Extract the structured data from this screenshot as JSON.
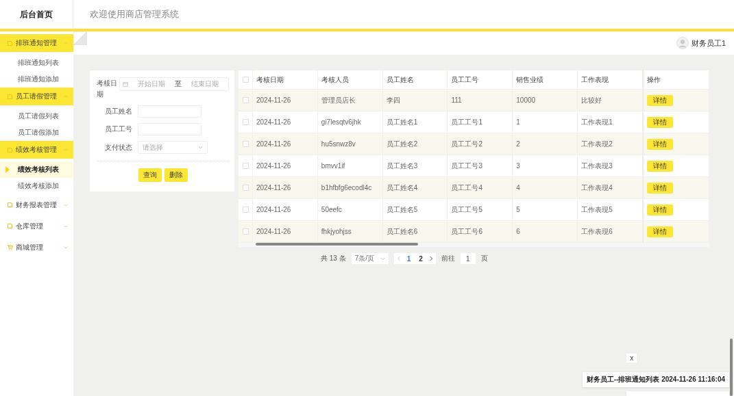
{
  "header": {
    "brand": "后台首页",
    "title": "欢迎使用商店管理系统"
  },
  "sidebar": {
    "groups": [
      {
        "label": "排班通知管理",
        "kind": "note",
        "expanded": true,
        "children": [
          {
            "label": "排班通知列表",
            "selected": false
          },
          {
            "label": "排班通知添加",
            "selected": false
          }
        ]
      },
      {
        "label": "员工请假管理",
        "kind": "note",
        "expanded": true,
        "children": [
          {
            "label": "员工请假列表",
            "selected": false
          },
          {
            "label": "员工请假添加",
            "selected": false
          }
        ]
      },
      {
        "label": "绩效考核管理",
        "kind": "note",
        "expanded": true,
        "children": [
          {
            "label": "绩效考核列表",
            "selected": true
          },
          {
            "label": "绩效考核添加",
            "selected": false
          }
        ]
      },
      {
        "label": "财务报表管理",
        "kind": "note",
        "expanded": false
      },
      {
        "label": "仓库管理",
        "kind": "note",
        "expanded": false
      },
      {
        "label": "商城管理",
        "kind": "cart",
        "expanded": false
      }
    ]
  },
  "user": {
    "name": "财务员工1"
  },
  "search_form": {
    "date_label": "考核日期",
    "start_placeholder": "开始日期",
    "separator": "至",
    "end_placeholder": "结束日期",
    "fields": [
      {
        "label": "员工姓名",
        "kind": "text"
      },
      {
        "label": "员工工号",
        "kind": "text"
      },
      {
        "label": "支付状态",
        "kind": "select",
        "placeholder": "请选择"
      }
    ],
    "buttons": [
      "查询",
      "删除"
    ]
  },
  "table": {
    "all_checked": false,
    "columns": [
      "考核日期",
      "考核人员",
      "员工姓名",
      "员工工号",
      "销售业绩",
      "工作表现",
      "操作"
    ],
    "rows": [
      {
        "checked": false,
        "cells": [
          "2024-11-26",
          "管理员店长",
          "李四",
          "111",
          "10000",
          "比较好"
        ],
        "action": "详情"
      },
      {
        "checked": false,
        "cells": [
          "2024-11-26",
          "gi7lesqtv6jhk",
          "员工姓名1",
          "员工工号1",
          "1",
          "工作表现1"
        ],
        "action": "详情"
      },
      {
        "checked": false,
        "cells": [
          "2024-11-26",
          "hu5snwz8v",
          "员工姓名2",
          "员工工号2",
          "2",
          "工作表现2"
        ],
        "action": "详情"
      },
      {
        "checked": false,
        "cells": [
          "2024-11-26",
          "bmvv1if",
          "员工姓名3",
          "员工工号3",
          "3",
          "工作表现3"
        ],
        "action": "详情"
      },
      {
        "checked": false,
        "cells": [
          "2024-11-26",
          "b1hfbfg6ecodl4c",
          "员工姓名4",
          "员工工号4",
          "4",
          "工作表现4"
        ],
        "action": "详情"
      },
      {
        "checked": false,
        "cells": [
          "2024-11-26",
          "50eefc",
          "员工姓名5",
          "员工工号5",
          "5",
          "工作表现5"
        ],
        "action": "详情"
      },
      {
        "checked": false,
        "cells": [
          "2024-11-26",
          "fhkjyohjss",
          "员工姓名6",
          "员工工号6",
          "6",
          "工作表现6"
        ],
        "action": "详情"
      }
    ]
  },
  "pagination": {
    "total": "共 13 条",
    "page_size": "7条/页",
    "pages": [
      {
        "label": "1",
        "selected": true
      },
      {
        "label": "2",
        "selected": false
      }
    ],
    "goto_label": "前往",
    "goto_value": "1",
    "goto_suffix": "页"
  },
  "notifications": {
    "close": "x",
    "items": [
      "财务员工--排班通知列表 2024-11-26 11:16:04"
    ]
  }
}
